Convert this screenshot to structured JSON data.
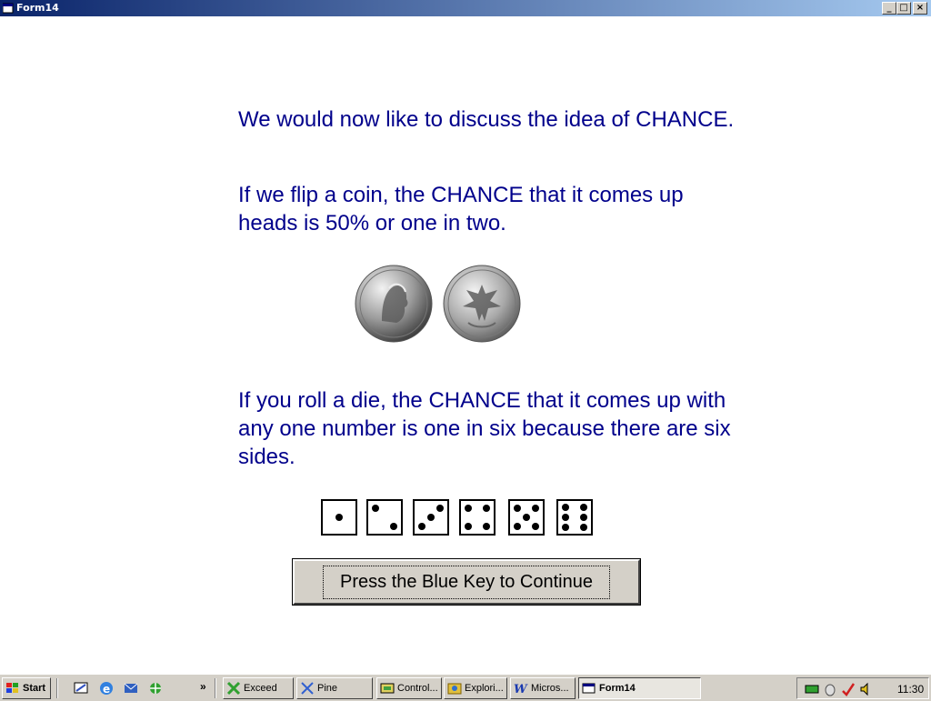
{
  "window": {
    "title": "Form14",
    "minimize_label": "_",
    "maximize_label": "□",
    "close_label": "×"
  },
  "content": {
    "paragraph1": "We would now like to discuss the idea of CHANCE.",
    "paragraph2": "If we flip a coin, the CHANCE that it comes up heads is 50% or one in two.",
    "paragraph3": "If you roll a die, the CHANCE that it comes up with any one number is one in six because there are six sides.",
    "coins": [
      "heads-coin",
      "tails-coin"
    ],
    "dice_faces": [
      1,
      2,
      3,
      4,
      5,
      6
    ],
    "continue_button": "Press the Blue Key to Continue",
    "text_color": "#00008b"
  },
  "taskbar": {
    "start_label": "Start",
    "quick_launch": [
      "desktop-icon",
      "ie-icon",
      "outlook-icon",
      "channel-icon"
    ],
    "more_label": "»",
    "tasks": [
      {
        "label": "Exceed",
        "icon": "exceed-icon"
      },
      {
        "label": "Pine",
        "icon": "pine-icon"
      },
      {
        "label": "Control...",
        "icon": "control-panel-icon"
      },
      {
        "label": "Explori...",
        "icon": "explorer-icon"
      },
      {
        "label": "Micros...",
        "icon": "word-icon"
      },
      {
        "label": "Form14",
        "icon": "form-icon",
        "active": true
      }
    ],
    "tray_icons": [
      "network-icon",
      "mouse-icon",
      "check-icon",
      "volume-icon"
    ],
    "clock": "11:30"
  }
}
